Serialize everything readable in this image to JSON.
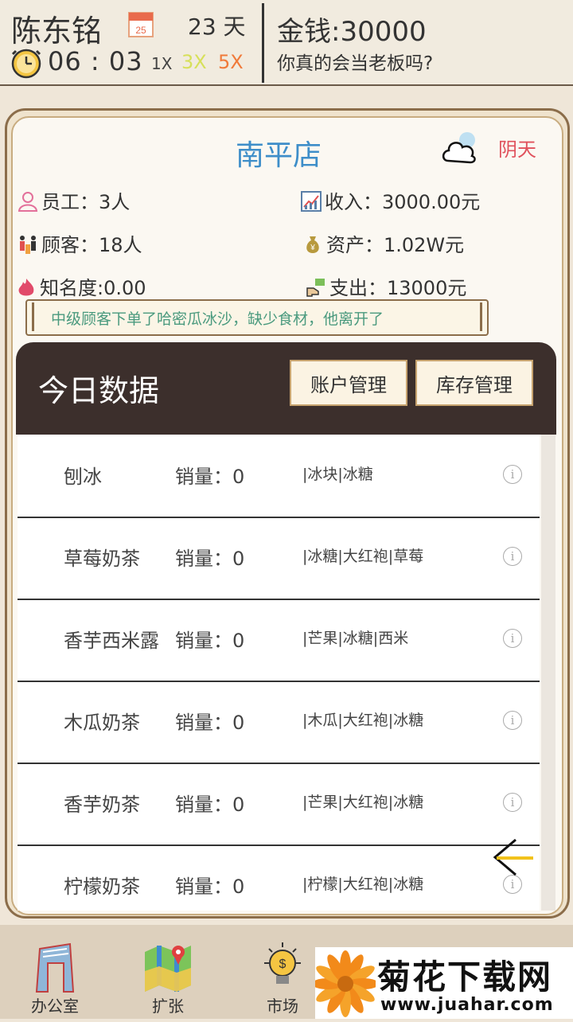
{
  "header": {
    "player_name": "陈东铭",
    "calendar_day": "25",
    "days": "23 天",
    "time": "06 : 03",
    "speed_options": [
      "1X",
      "3X",
      "5X"
    ],
    "money": "金钱:30000",
    "slogan": "你真的会当老板吗?"
  },
  "store": {
    "name": "南平店",
    "weather": "阴天",
    "employees": "员工：3人",
    "customers": "顾客：18人",
    "fame": "知名度:0.00",
    "income": "收入：3000.00元",
    "assets": "资产：1.02W元",
    "expense": "支出：13000元",
    "notice": "中级顾客下单了哈密瓜冰沙，缺少食材，他离开了"
  },
  "panel": {
    "title": "今日数据",
    "account_button": "账户管理",
    "stock_button": "库存管理",
    "sales_label": "销量：",
    "products": [
      {
        "name": "刨冰",
        "sales": "0",
        "ingredients": "|冰块|冰糖"
      },
      {
        "name": "草莓奶茶",
        "sales": "0",
        "ingredients": "|冰糖|大红袍|草莓"
      },
      {
        "name": "香芋西米露",
        "sales": "0",
        "ingredients": "|芒果|冰糖|西米"
      },
      {
        "name": "木瓜奶茶",
        "sales": "0",
        "ingredients": "|木瓜|大红袍|冰糖"
      },
      {
        "name": "香芋奶茶",
        "sales": "0",
        "ingredients": "|芒果|大红袍|冰糖"
      },
      {
        "name": "柠檬奶茶",
        "sales": "0",
        "ingredients": "|柠檬|大红袍|冰糖"
      }
    ]
  },
  "nav": {
    "office": "办公室",
    "expand": "扩张",
    "market": "市场"
  },
  "watermark": {
    "title": "菊花下载网",
    "url": "www.juahar.com"
  },
  "colors": {
    "store_title": "#3e8ec9",
    "weather": "#e0515c",
    "speed_3x": "#d7e05a",
    "speed_5x": "#f07a3a",
    "panel_header": "#3c2f2c",
    "notice_text": "#4a9a7e"
  }
}
